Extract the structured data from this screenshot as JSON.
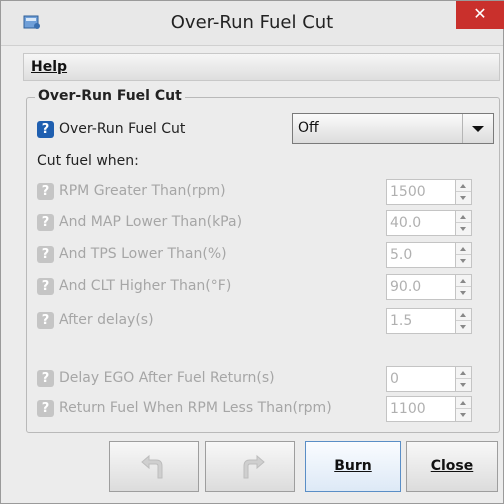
{
  "window": {
    "title": "Over-Run Fuel Cut",
    "close_glyph": "✕"
  },
  "menu": {
    "help": "Help"
  },
  "group": {
    "title": "Over-Run Fuel Cut"
  },
  "main_setting": {
    "label": "Over-Run Fuel Cut",
    "value": "Off",
    "help_glyph": "?"
  },
  "cut_fuel_when": "Cut fuel when:",
  "rows": [
    {
      "label": "RPM Greater Than(rpm)",
      "value": "1500"
    },
    {
      "label": "And MAP Lower Than(kPa)",
      "value": "40.0"
    },
    {
      "label": "And TPS Lower Than(%)",
      "value": "5.0"
    },
    {
      "label": "And CLT Higher Than(°F)",
      "value": "90.0"
    },
    {
      "label": "After delay(s)",
      "value": "1.5"
    },
    {
      "label": "Delay EGO After Fuel Return(s)",
      "value": "0"
    },
    {
      "label": "Return Fuel When RPM Less Than(rpm)",
      "value": "1100"
    }
  ],
  "buttons": {
    "burn": "Burn",
    "close": "Close"
  },
  "icons": {
    "undo": "undo-icon",
    "redo": "redo-icon",
    "help": "help-icon",
    "app": "app-icon"
  },
  "colors": {
    "close_button": "#c9302c",
    "help_active": "#1f5fb0",
    "disabled_text": "#a6a6a6"
  }
}
